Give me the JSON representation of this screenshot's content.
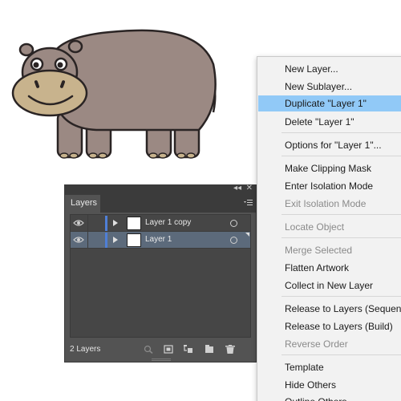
{
  "layers_panel": {
    "tab_label": "Layers",
    "collapse_glyph": "◂◂",
    "close_glyph": "✕",
    "layers": [
      {
        "name": "Layer 1 copy",
        "selected": false
      },
      {
        "name": "Layer 1",
        "selected": true
      }
    ],
    "layer_count": "2 Layers",
    "layer_color": "#4f7fd6"
  },
  "context_menu": {
    "items": [
      {
        "label": "New Layer...",
        "state": "enabled"
      },
      {
        "label": "New Sublayer...",
        "state": "enabled"
      },
      {
        "label": "Duplicate \"Layer 1\"",
        "state": "highlighted"
      },
      {
        "label": "Delete \"Layer 1\"",
        "state": "enabled"
      },
      {
        "label": "Options for \"Layer 1\"...",
        "state": "enabled"
      },
      {
        "label": "Make Clipping Mask",
        "state": "enabled"
      },
      {
        "label": "Enter Isolation Mode",
        "state": "enabled"
      },
      {
        "label": "Exit Isolation Mode",
        "state": "disabled"
      },
      {
        "label": "Locate Object",
        "state": "disabled"
      },
      {
        "label": "Merge Selected",
        "state": "disabled"
      },
      {
        "label": "Flatten Artwork",
        "state": "enabled"
      },
      {
        "label": "Collect in New Layer",
        "state": "enabled"
      },
      {
        "label": "Release to Layers (Sequence)",
        "state": "enabled"
      },
      {
        "label": "Release to Layers (Build)",
        "state": "enabled"
      },
      {
        "label": "Reverse Order",
        "state": "disabled"
      },
      {
        "label": "Template",
        "state": "enabled"
      },
      {
        "label": "Hide Others",
        "state": "enabled"
      },
      {
        "label": "Outline Others",
        "state": "enabled"
      }
    ],
    "highlight_color": "#91c9f7"
  }
}
